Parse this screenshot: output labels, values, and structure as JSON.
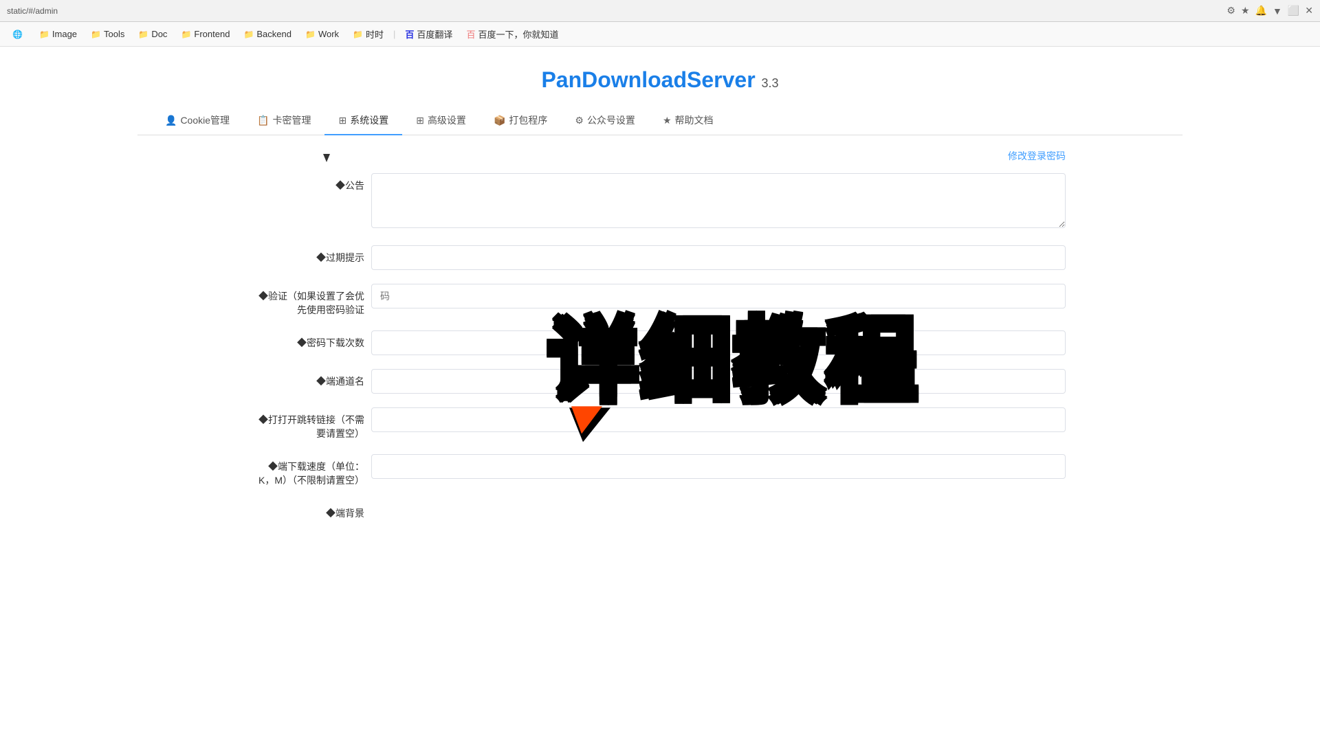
{
  "browser": {
    "url": "static/#/admin",
    "icons": [
      "⚙",
      "★",
      "🔔",
      "▼",
      "⬜",
      "✕"
    ]
  },
  "bookmarks": [
    {
      "name": "Network",
      "icon": "🌐",
      "label": ""
    },
    {
      "name": "Image",
      "icon": "📁",
      "label": "Image"
    },
    {
      "name": "Tools",
      "icon": "📁",
      "label": "Tools"
    },
    {
      "name": "Doc",
      "icon": "📁",
      "label": "Doc"
    },
    {
      "name": "Frontend",
      "icon": "📁",
      "label": "Frontend"
    },
    {
      "name": "Backend",
      "icon": "📁",
      "label": "Backend"
    },
    {
      "name": "Work",
      "icon": "📁",
      "label": "Work"
    },
    {
      "name": "时时",
      "icon": "📁",
      "label": "时时"
    },
    {
      "name": "BaiduFanyi",
      "icon": "百",
      "label": "百度翻译",
      "special": "baidu"
    },
    {
      "name": "BaiduSearch",
      "icon": "百",
      "label": "百度一下，你就知道",
      "special": "baidu"
    }
  ],
  "header": {
    "title": "PanDownloadServer",
    "version": "3.3"
  },
  "tabs": [
    {
      "id": "cookie",
      "icon": "👤",
      "label": "Cookie管理",
      "active": false
    },
    {
      "id": "cardkey",
      "icon": "📋",
      "label": "卡密管理",
      "active": false
    },
    {
      "id": "system",
      "icon": "⚙",
      "label": "系统设置",
      "active": true
    },
    {
      "id": "advanced",
      "icon": "⊞",
      "label": "高级设置",
      "active": false
    },
    {
      "id": "package",
      "icon": "📦",
      "label": "打包程序",
      "active": false
    },
    {
      "id": "wechat",
      "icon": "⚙",
      "label": "公众号设置",
      "active": false
    },
    {
      "id": "help",
      "icon": "★",
      "label": "帮助文档",
      "active": false
    }
  ],
  "form": {
    "change_password_label": "修改登录密码",
    "announcement_label": "◆公告",
    "announcement_value": "",
    "expiry_hint_label": "◆过期提示",
    "expiry_hint_value": "",
    "verify_label": "◆验证（如果设置了会优先使用密码验证",
    "verify_placeholder": "码",
    "password_downloads_label": "◆密码下载次数",
    "password_downloads_value": "",
    "channel_name_label": "◆端通道名",
    "channel_name_value": "",
    "redirect_label": "◆打打开跳转链接（不需要请置空）",
    "redirect_value": "",
    "download_speed_label": "◆端下载速度（单位：K，M）（不限制请置空）",
    "download_speed_value": "",
    "backend_bg_label": "◆端背景"
  },
  "watermark": {
    "text": "详细教程"
  }
}
